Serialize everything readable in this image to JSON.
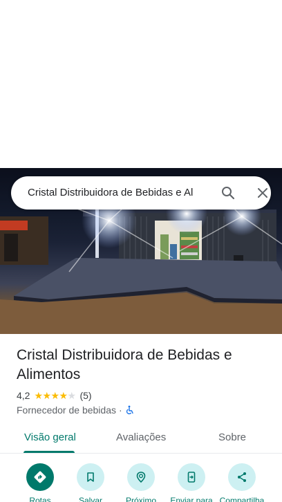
{
  "search": {
    "query": "Cristal Distribuidora de Bebidas e Al"
  },
  "photo": {
    "description_icon": "storefront-photo"
  },
  "place": {
    "title": "Cristal Distribuidora de Bebidas e Alimentos",
    "rating": "4,2",
    "rating_stars": 4,
    "review_count": "(5)",
    "category": "Fornecedor de bebidas",
    "separator": "·"
  },
  "tabs": [
    {
      "label": "Visão geral",
      "active": true
    },
    {
      "label": "Avaliações",
      "active": false
    },
    {
      "label": "Sobre",
      "active": false
    }
  ],
  "actions": [
    {
      "label": "Rotas",
      "icon": "directions-icon"
    },
    {
      "label": "Salvar",
      "icon": "bookmark-icon"
    },
    {
      "label": "Próximo",
      "icon": "nearby-icon"
    },
    {
      "label": "Enviar para",
      "icon": "send-to-phone-icon"
    },
    {
      "label": "Compartilha",
      "icon": "share-icon"
    }
  ],
  "colors": {
    "accent": "#00796b",
    "action_bg": "#cdf0f2",
    "star": "#fbbc04",
    "wheelchair": "#1a73e8"
  }
}
